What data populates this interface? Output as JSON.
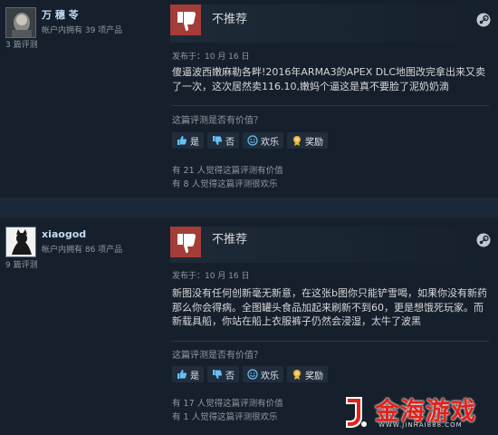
{
  "reviews": [
    {
      "username": "万 穗 苓",
      "products_owned": "帐户内拥有 39 项产品",
      "review_count": "3 篇评测",
      "verdict": "不推荐",
      "posted": "发布于：10 月 16 日",
      "content": "傻逼波西嫩麻勒各畔!2016年ARMA3的APEX DLC地图改完拿出来又卖了一次，这次居然卖116.10,嫩妈个逼这是真不要脸了泥奶奶滴",
      "helpful_question": "这篇评测是否有价值？",
      "buttons": {
        "yes": "是",
        "no": "否",
        "funny": "欢乐",
        "award": "奖励"
      },
      "helpful_count": "有 21 人觉得这篇评测有价值",
      "funny_count": "有 8 人觉得这篇评测很欢乐"
    },
    {
      "username": "xiaogod",
      "products_owned": "帐户内拥有 86 项产品",
      "review_count": "9 篇评测",
      "verdict": "不推荐",
      "posted": "发布于：10 月 16 日",
      "content": "新图没有任何创新毫无新意，在这张b图你只能铲雪喝，如果你没有新药那么你会得病。全图罐头食品加起来刷新不到60，更是想饿死玩家。而新载具船，你站在船上衣服裤子仍然会浸湿，太牛了波黑",
      "helpful_question": "这篇评测是否有价值？",
      "buttons": {
        "yes": "是",
        "no": "否",
        "funny": "欢乐",
        "award": "奖励"
      },
      "helpful_count": "有 17 人觉得这篇评测有价值",
      "funny_count": "有 1 人觉得这篇评测很欢乐"
    }
  ],
  "watermark": {
    "brand": "金海游戏",
    "url": "WWW.JINHAI888.COM"
  },
  "colors": {
    "background": "#1b2838",
    "card": "#16202d",
    "not_recommended": "#a43d38",
    "link_blue": "#67c1f5",
    "watermark_red": "#e2231a"
  },
  "icons": [
    "thumbs-down-icon",
    "steam-icon",
    "thumbs-up-icon",
    "smiley-icon",
    "award-icon"
  ]
}
